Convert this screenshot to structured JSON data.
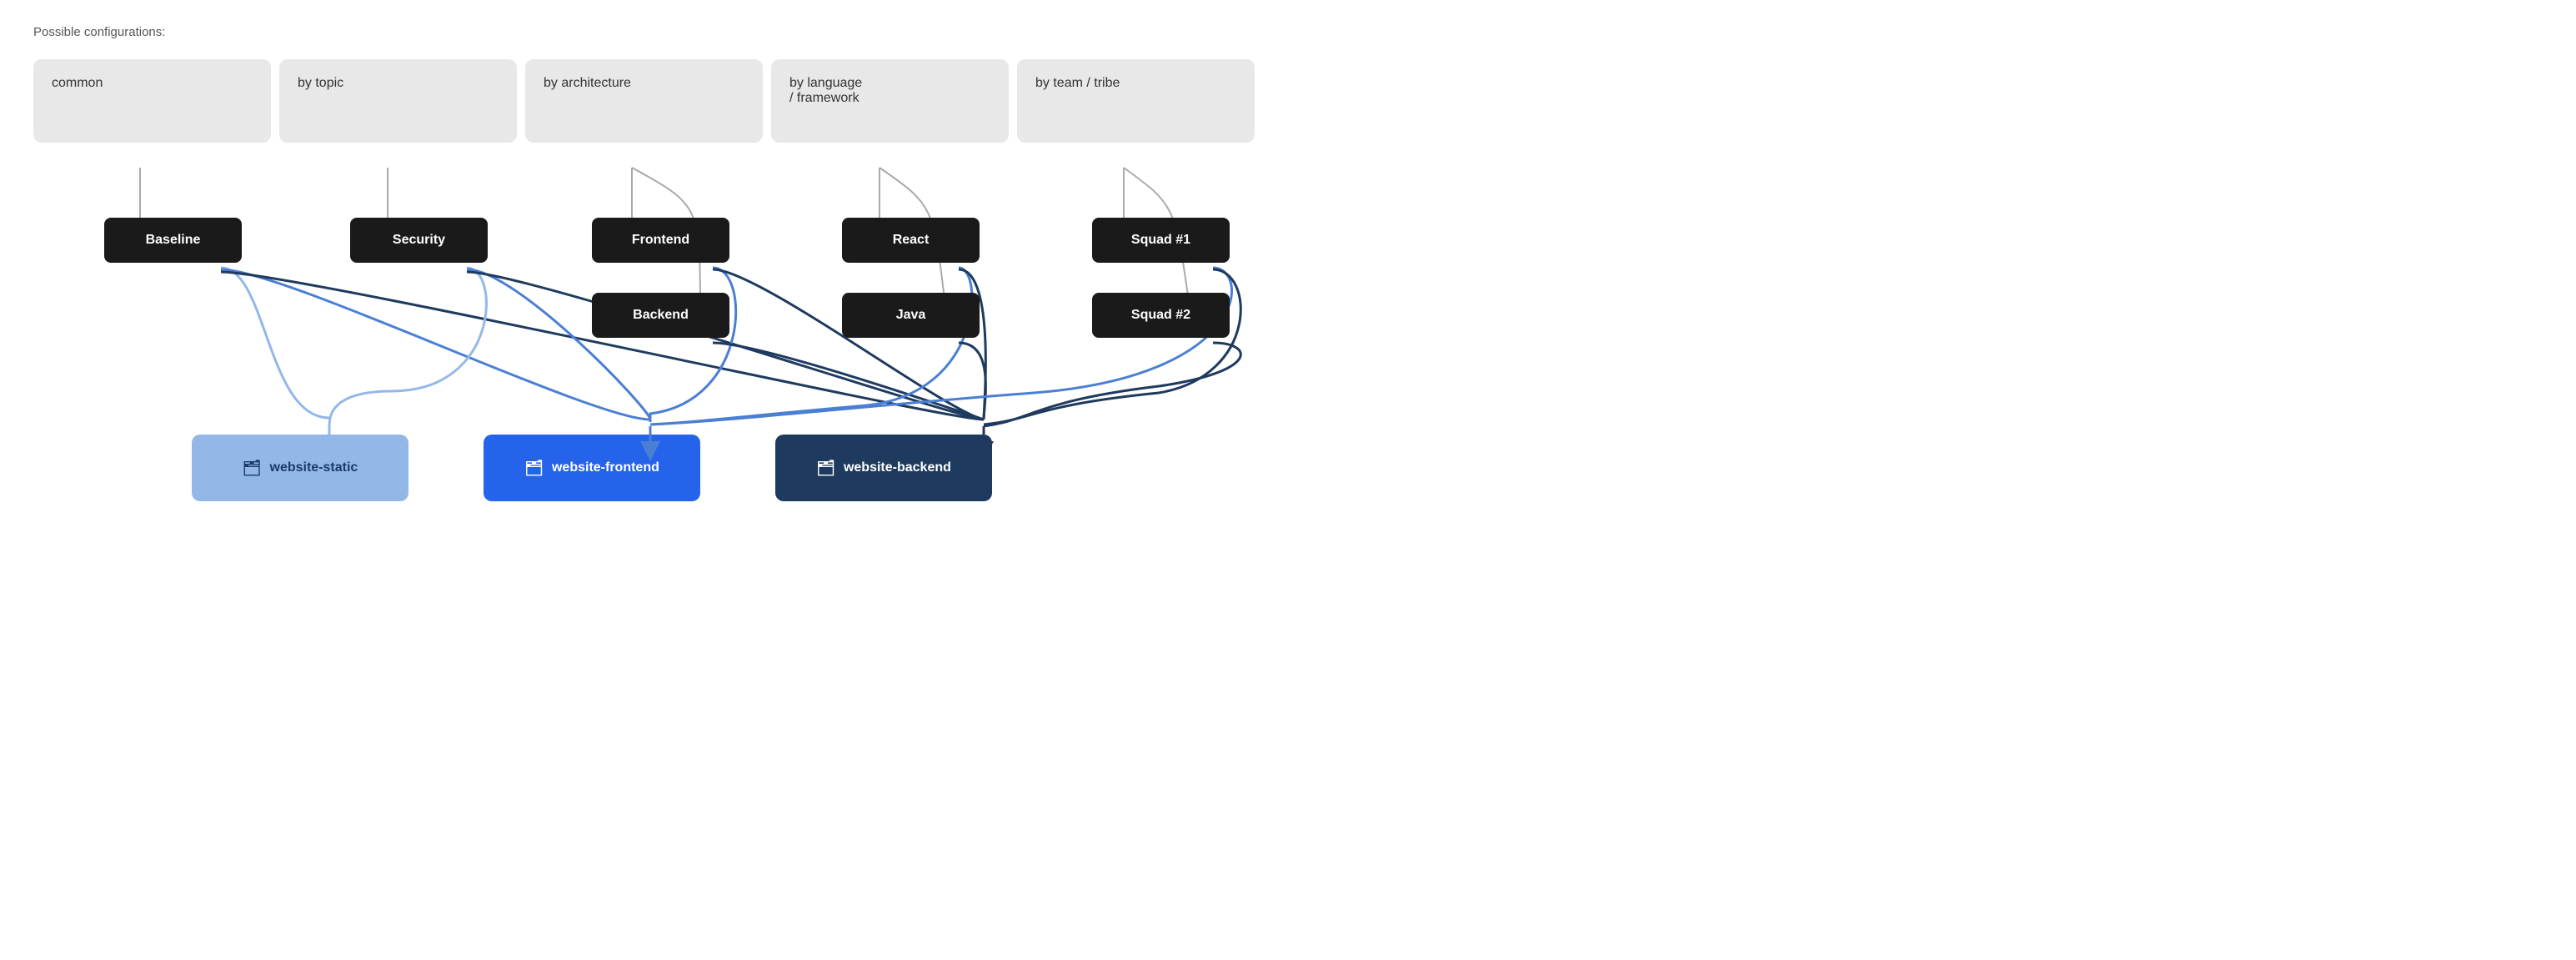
{
  "header": {
    "possible_configs_label": "Possible configurations:"
  },
  "categories": [
    {
      "id": "common",
      "label": "common"
    },
    {
      "id": "by-topic",
      "label": "by topic"
    },
    {
      "id": "by-architecture",
      "label": "by architecture"
    },
    {
      "id": "by-language-framework",
      "label": "by language\n/ framework"
    },
    {
      "id": "by-team-tribe",
      "label": "by team / tribe"
    }
  ],
  "nodes": {
    "baseline": "Baseline",
    "security": "Security",
    "frontend": "Frontend",
    "backend": "Backend",
    "react": "React",
    "java": "Java",
    "squad1": "Squad #1",
    "squad2": "Squad #2"
  },
  "outputs": [
    {
      "id": "website-static",
      "label": "website-static",
      "style": "light-blue"
    },
    {
      "id": "website-frontend",
      "label": "website-frontend",
      "style": "mid-blue"
    },
    {
      "id": "website-backend",
      "label": "website-backend",
      "style": "dark-blue"
    }
  ],
  "icons": {
    "folder": "🗂"
  }
}
